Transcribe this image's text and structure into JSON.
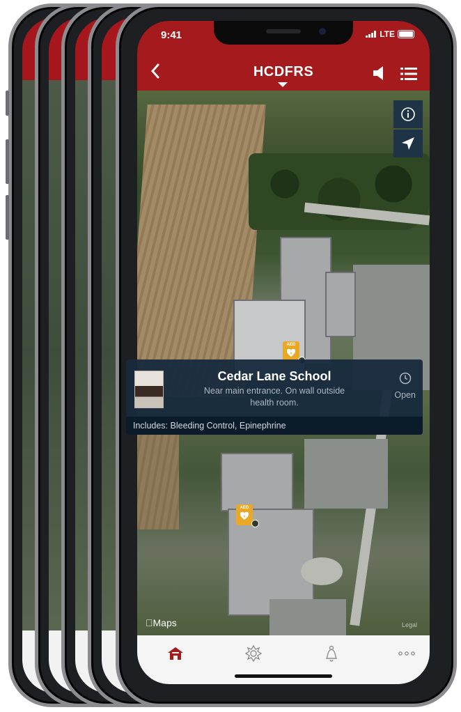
{
  "status_bar": {
    "time": "9:41",
    "network": "LTE"
  },
  "header": {
    "title": "HCDFRS",
    "back_icon": "chevron-left-icon",
    "sound_icon": "speaker-icon",
    "menu_icon": "list-icon",
    "background_color": "#a51a1d"
  },
  "map": {
    "controls": [
      "info-icon",
      "location-arrow-icon"
    ],
    "attribution": "Maps",
    "legal": "Legal",
    "pins": [
      {
        "label": "AED",
        "icon": "aed-heart-icon"
      },
      {
        "label": "AED",
        "icon": "aed-heart-icon"
      }
    ]
  },
  "callout": {
    "name": "Cedar Lane School",
    "description": "Near main entrance. On wall outside health room.",
    "status": "Open",
    "status_icon": "clock-icon",
    "includes": "Includes: Bleeding Control, Epinephrine",
    "background_color": "#172a3d"
  },
  "tab_bar": {
    "items": [
      {
        "name": "home",
        "icon": "firehouse-icon",
        "active": true
      },
      {
        "name": "fire-department",
        "icon": "maltese-cross-icon",
        "active": false
      },
      {
        "name": "alerts",
        "icon": "bell-icon",
        "active": false
      },
      {
        "name": "more",
        "icon": "more-dots-icon",
        "active": false
      }
    ],
    "active_color": "#a51a1d"
  }
}
